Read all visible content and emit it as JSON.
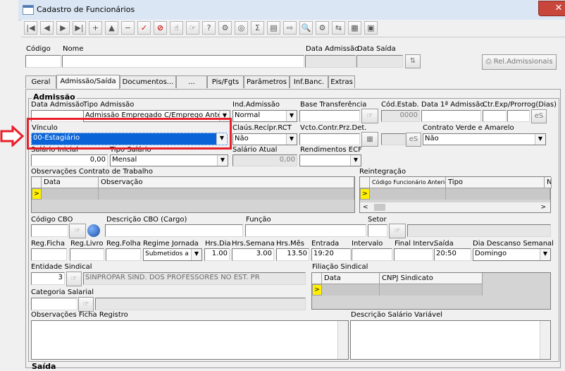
{
  "window": {
    "title": "Cadastro de Funcionários",
    "close_label": "✕"
  },
  "toolbar": {
    "buttons": [
      "|◀",
      "◀",
      "▶",
      "▶|",
      "+",
      "−",
      "✓",
      "⊘",
      "☝",
      "☞",
      "?",
      "⚙",
      "◎",
      "Σ",
      "▤",
      "⇨",
      "🔍",
      "⚙",
      "⇆",
      "▦",
      "▣"
    ]
  },
  "header": {
    "codigo_label": "Código",
    "nome_label": "Nome",
    "data_admissao_label": "Data Admissão",
    "data_saida_label": "Data Saída",
    "rel_admissionais": "Rel.Admissionais"
  },
  "tabs": [
    "Geral",
    "Admissão/Saída",
    "Documentos...",
    "...",
    "Pis/Fgts",
    "Parâmetros",
    "Inf.Banc.",
    "Extras"
  ],
  "admissao": {
    "group_title": "Admissão",
    "data_admissao_label": "Data Admissão",
    "tipo_admissao_label": "Tipo Admissão",
    "tipo_admissao_value": "Admissão Empregado C/Emprego Anterior",
    "ind_admissao_label": "Ind.Admissão",
    "ind_admissao_value": "Normal",
    "base_transf_label": "Base Transferência",
    "cod_estab_label": "Cód.Estab.",
    "cod_estab_value": "0000",
    "data_1_admissao_label": "Data 1ª Admissão",
    "ctr_exp_label": "Ctr.Exp/Prorrog(Dias)",
    "es_label": "eS",
    "vinculo_label": "Vínculo",
    "vinculo_value": "00-Estagiário",
    "claus_recipr_label": "Claús.Recípr.RCT",
    "claus_recipr_value": "Não",
    "vcto_contr_label": "Vcto.Contr.Prz.Det.",
    "contrato_verde_label": "Contrato Verde e Amarelo",
    "contrato_verde_value": "Não",
    "salario_inicial_label": "Salário Inicial",
    "salario_inicial_value": "0,00",
    "tipo_salario_label": "Tipo Salário",
    "tipo_salario_value": "Mensal",
    "salario_atual_label": "Salário Atual",
    "salario_atual_value": "0,00",
    "rendimentos_ecf_label": "Rendimentos ECF",
    "obs_contrato_label": "Observações Contrato de Trabalho",
    "obs_cols": [
      "Data",
      "Observação"
    ],
    "reintegracao_label": "Reintegração",
    "reint_cols": [
      "Código Funcionário Anterior",
      "Tipo",
      "N"
    ],
    "codigo_cbo_label": "Código CBO",
    "descricao_cbo_label": "Descrição CBO (Cargo)",
    "funcao_label": "Função",
    "setor_label": "Setor",
    "reg_ficha_label": "Reg.Ficha",
    "reg_livro_label": "Reg.Livro",
    "reg_folha_label": "Reg.Folha",
    "regime_jornada_label": "Regime Jornada",
    "regime_jornada_value": "Submetidos a H",
    "hrs_dia_label": "Hrs.Dia",
    "hrs_dia_value": "1.00",
    "hrs_semana_label": "Hrs.Semana",
    "hrs_semana_value": "3.00",
    "hrs_mes_label": "Hrs.Mês",
    "hrs_mes_value": "13.50",
    "entrada_label": "Entrada",
    "entrada_value": "19:20",
    "intervalo_label": "Intervalo",
    "final_interv_label": "Final Interv.",
    "saida_label": "Saída",
    "saida_value": "20:50",
    "dia_descanso_label": "Dia Descanso Semanal",
    "dia_descanso_value": "Domingo",
    "entidade_sindical_label": "Entidade Sindical",
    "entidade_sindical_code": "3",
    "entidade_sindical_name": "SINPROPAR SIND. DOS PROFESSORES NO EST. PR",
    "filiacao_label": "Filiação Sindical",
    "filiacao_cols": [
      "Data",
      "CNPJ Sindicato"
    ],
    "categoria_salarial_label": "Categoria Salarial",
    "obs_ficha_label": "Observações Ficha Registro",
    "desc_salario_var_label": "Descrição Salário Variável",
    "saida_group_label": "Saída"
  },
  "colors": {
    "highlight": "#e8202a",
    "selected": "#0a64d8",
    "row_marker": "#ffef00"
  }
}
